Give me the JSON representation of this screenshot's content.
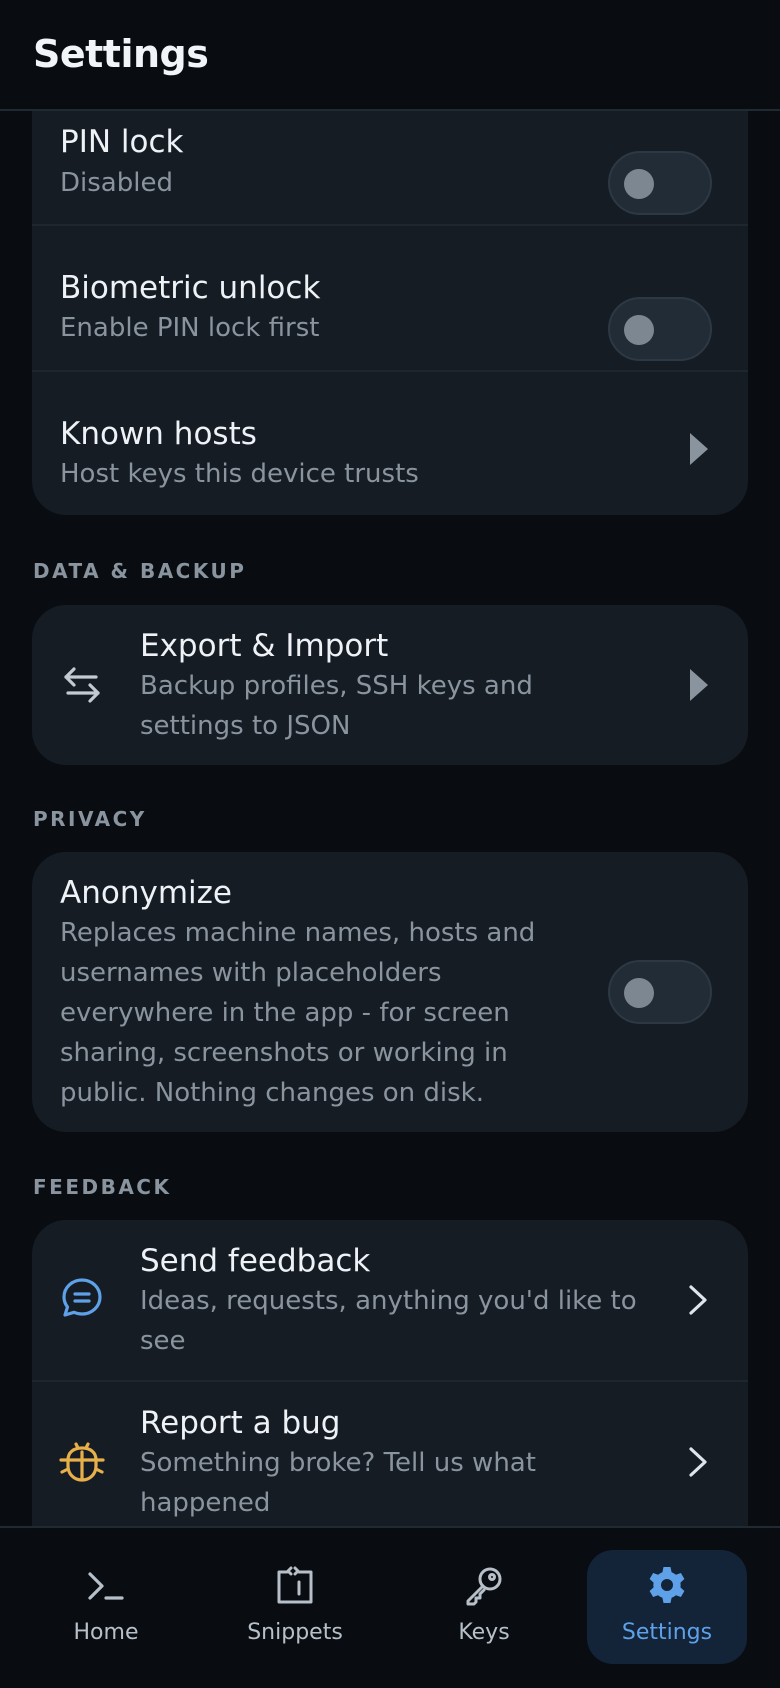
{
  "header": {
    "title": "Settings"
  },
  "security": {
    "pin_lock": {
      "title": "PIN lock",
      "subtitle": "Disabled",
      "enabled": false
    },
    "biometric": {
      "title": "Biometric unlock",
      "subtitle": "Enable PIN lock first",
      "enabled": false
    },
    "known_hosts": {
      "title": "Known hosts",
      "subtitle": "Host keys this device trusts"
    }
  },
  "data_backup": {
    "label": "DATA & BACKUP",
    "export_import": {
      "title": "Export & Import",
      "subtitle": "Backup profiles, SSH keys and settings to JSON",
      "icon": "swap-arrows-icon"
    }
  },
  "privacy": {
    "label": "PRIVACY",
    "anonymize": {
      "title": "Anonymize",
      "subtitle": "Replaces machine names, hosts and usernames with placeholders everywhere in the app - for screen sharing, screenshots or working in public. Nothing changes on disk.",
      "enabled": false
    }
  },
  "feedback": {
    "label": "FEEDBACK",
    "send_feedback": {
      "title": "Send feedback",
      "subtitle": "Ideas, requests, anything you'd like to see",
      "icon": "chat-bubble-icon"
    },
    "report_bug": {
      "title": "Report a bug",
      "subtitle": "Something broke? Tell us what happened",
      "icon": "bug-icon"
    }
  },
  "nav": {
    "items": [
      {
        "label": "Home",
        "icon": "terminal-icon"
      },
      {
        "label": "Snippets",
        "icon": "snippet-icon"
      },
      {
        "label": "Keys",
        "icon": "key-icon"
      },
      {
        "label": "Settings",
        "icon": "gear-icon",
        "active": true
      }
    ]
  },
  "colors": {
    "accent": "#5ea1e8",
    "bug_icon": "#e8b04a",
    "card": "#151c24",
    "background": "#090d12"
  }
}
